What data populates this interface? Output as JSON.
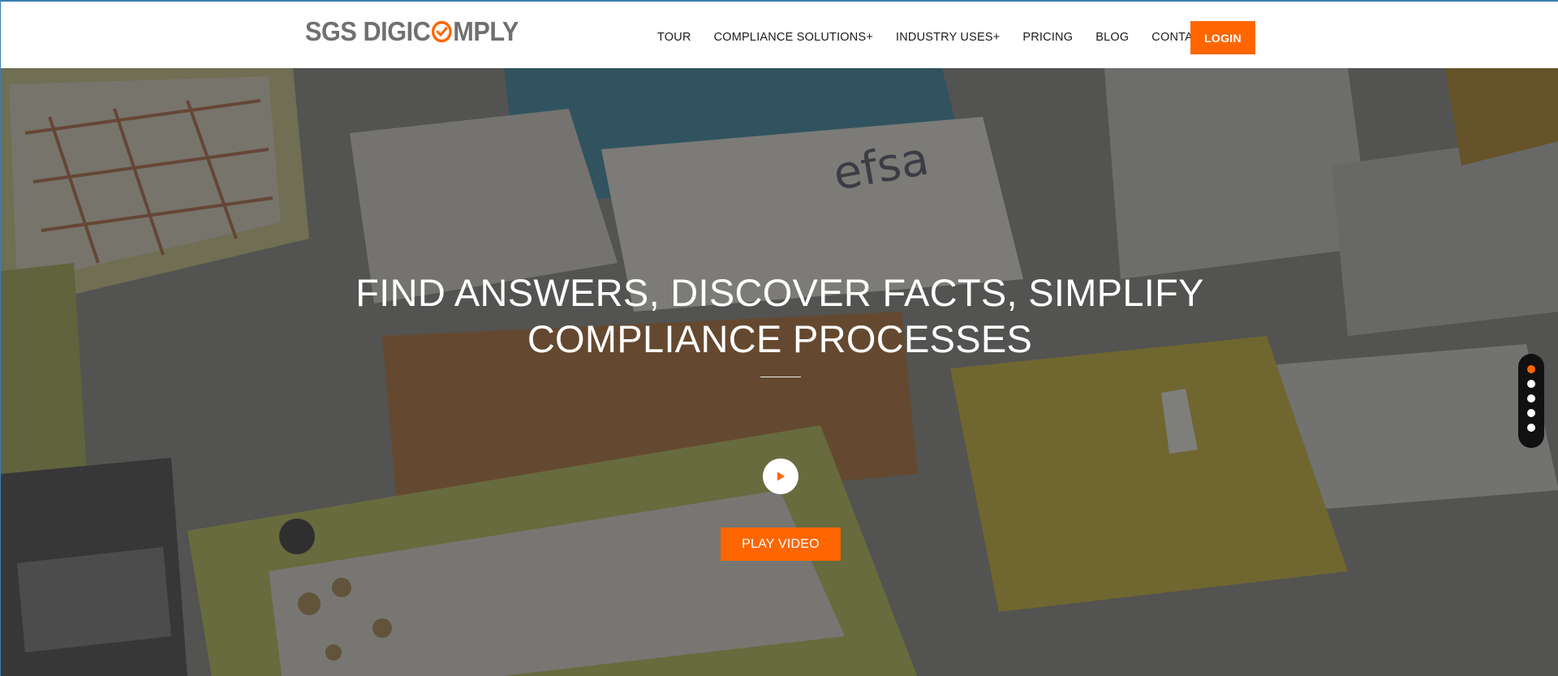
{
  "brand": {
    "logo_before": "SGS DIGIC",
    "logo_after": "MPLY",
    "logo_mark_icon": "check-circle-icon",
    "accent_color": "#ff6600"
  },
  "nav": {
    "items": [
      {
        "label": "TOUR"
      },
      {
        "label": "COMPLIANCE SOLUTIONS+"
      },
      {
        "label": "INDUSTRY USES+"
      },
      {
        "label": "PRICING"
      },
      {
        "label": "BLOG"
      },
      {
        "label": "CONTACT US"
      }
    ],
    "login_label": "LOGIN"
  },
  "hero": {
    "title_line1": "FIND ANSWERS, DISCOVER FACTS, SIMPLIFY",
    "title_line2": "COMPLIANCE PROCESSES",
    "play_icon": "play-icon",
    "play_video_label": "PLAY VIDEO",
    "background_text": "efsa"
  },
  "slider": {
    "total_slides": 5,
    "active_index": 0
  }
}
